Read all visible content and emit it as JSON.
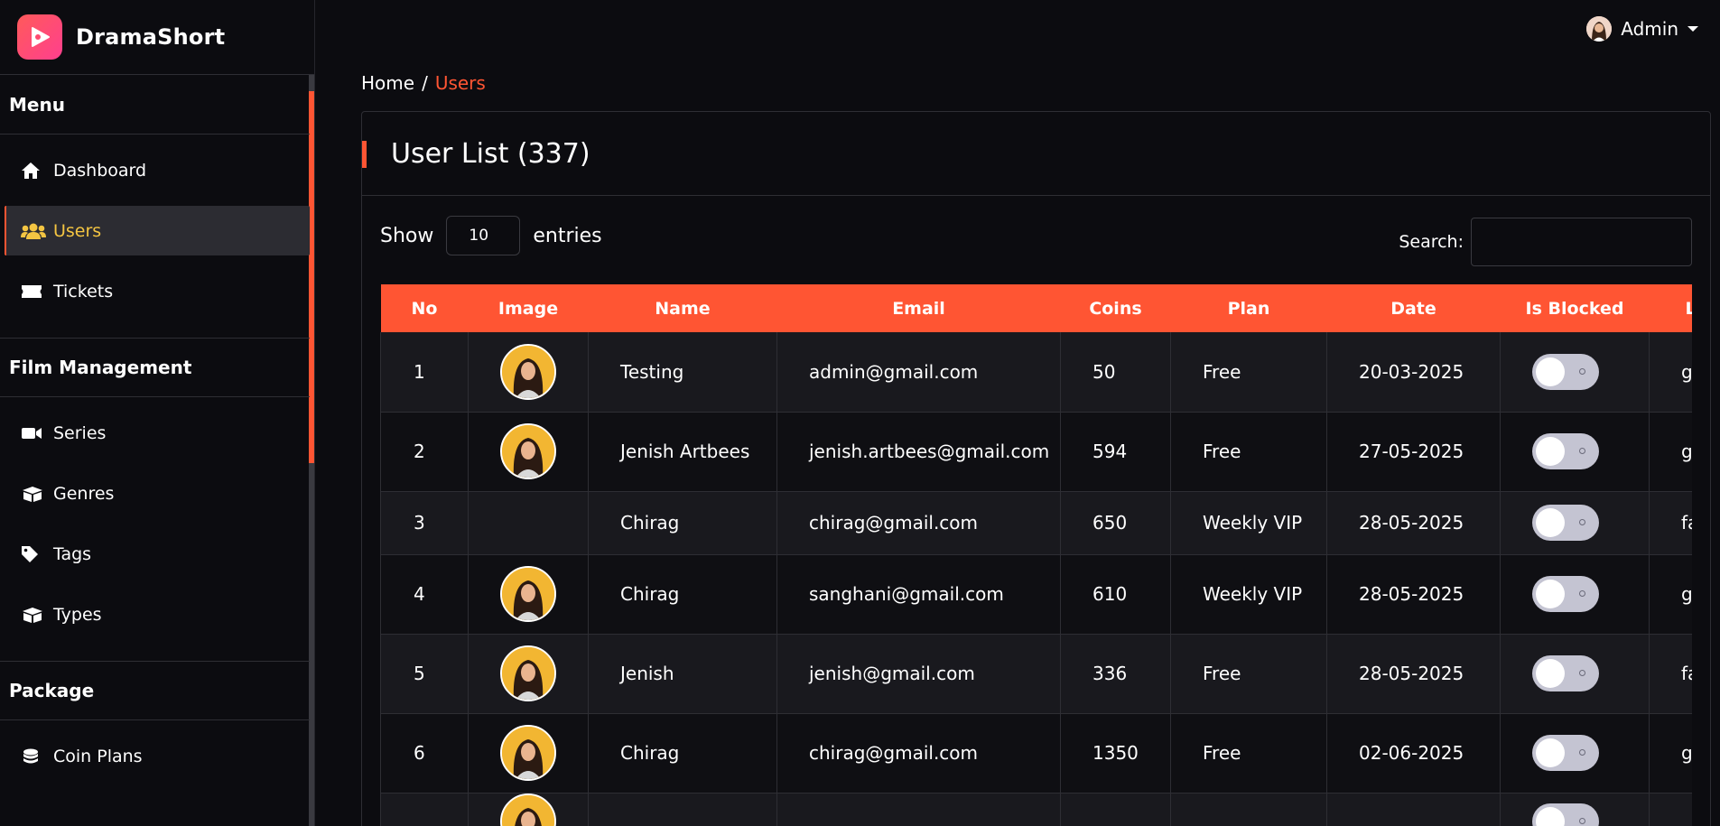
{
  "brand": {
    "name": "DramaShort"
  },
  "sidebar": {
    "sections": [
      {
        "title": "Menu",
        "items": [
          {
            "label": "Dashboard",
            "icon": "home-icon",
            "active": false
          },
          {
            "label": "Users",
            "icon": "users-icon",
            "active": true
          },
          {
            "label": "Tickets",
            "icon": "ticket-icon",
            "active": false
          }
        ]
      },
      {
        "title": "Film Management",
        "items": [
          {
            "label": "Series",
            "icon": "video-camera-icon",
            "active": false
          },
          {
            "label": "Genres",
            "icon": "box-icon",
            "active": false
          },
          {
            "label": "Tags",
            "icon": "tag-icon",
            "active": false
          },
          {
            "label": "Types",
            "icon": "box-icon",
            "active": false
          }
        ]
      },
      {
        "title": "Package",
        "items": [
          {
            "label": "Coin Plans",
            "icon": "coins-icon",
            "active": false
          }
        ]
      }
    ]
  },
  "topbar": {
    "user": "Admin"
  },
  "breadcrumb": {
    "home": "Home",
    "separator": "/",
    "current": "Users"
  },
  "card": {
    "title": "User List (337)"
  },
  "controls": {
    "show_label": "Show",
    "entries_value": "10",
    "entries_label": "entries",
    "search_label": "Search:"
  },
  "table": {
    "columns": [
      "No",
      "Image",
      "Name",
      "Email",
      "Coins",
      "Plan",
      "Date",
      "Is Blocked",
      "L"
    ],
    "rows": [
      {
        "no": "1",
        "has_image": true,
        "name": "Testing",
        "email": "admin@gmail.com",
        "coins": "50",
        "plan": "Free",
        "date": "20-03-2025",
        "blocked": false,
        "extra": "g"
      },
      {
        "no": "2",
        "has_image": true,
        "name": "Jenish Artbees",
        "email": "jenish.artbees@gmail.com",
        "coins": "594",
        "plan": "Free",
        "date": "27-05-2025",
        "blocked": false,
        "extra": "g"
      },
      {
        "no": "3",
        "has_image": false,
        "name": "Chirag",
        "email": "chirag@gmail.com",
        "coins": "650",
        "plan": "Weekly VIP",
        "date": "28-05-2025",
        "blocked": false,
        "extra": "fa"
      },
      {
        "no": "4",
        "has_image": true,
        "name": "Chirag",
        "email": "sanghani@gmail.com",
        "coins": "610",
        "plan": "Weekly VIP",
        "date": "28-05-2025",
        "blocked": false,
        "extra": "g"
      },
      {
        "no": "5",
        "has_image": true,
        "name": "Jenish",
        "email": "jenish@gmail.com",
        "coins": "336",
        "plan": "Free",
        "date": "28-05-2025",
        "blocked": false,
        "extra": "fa"
      },
      {
        "no": "6",
        "has_image": true,
        "name": "Chirag",
        "email": "chirag@gmail.com",
        "coins": "1350",
        "plan": "Free",
        "date": "02-06-2025",
        "blocked": false,
        "extra": "g"
      },
      {
        "no": "",
        "has_image": true,
        "name": "",
        "email": "",
        "coins": "",
        "plan": "",
        "date": "",
        "blocked": false,
        "extra": ""
      }
    ]
  },
  "colors": {
    "accent": "#ff5533",
    "active_text": "#f4c542",
    "background": "#0c0c10",
    "avatar_bg": "#f2b632"
  }
}
